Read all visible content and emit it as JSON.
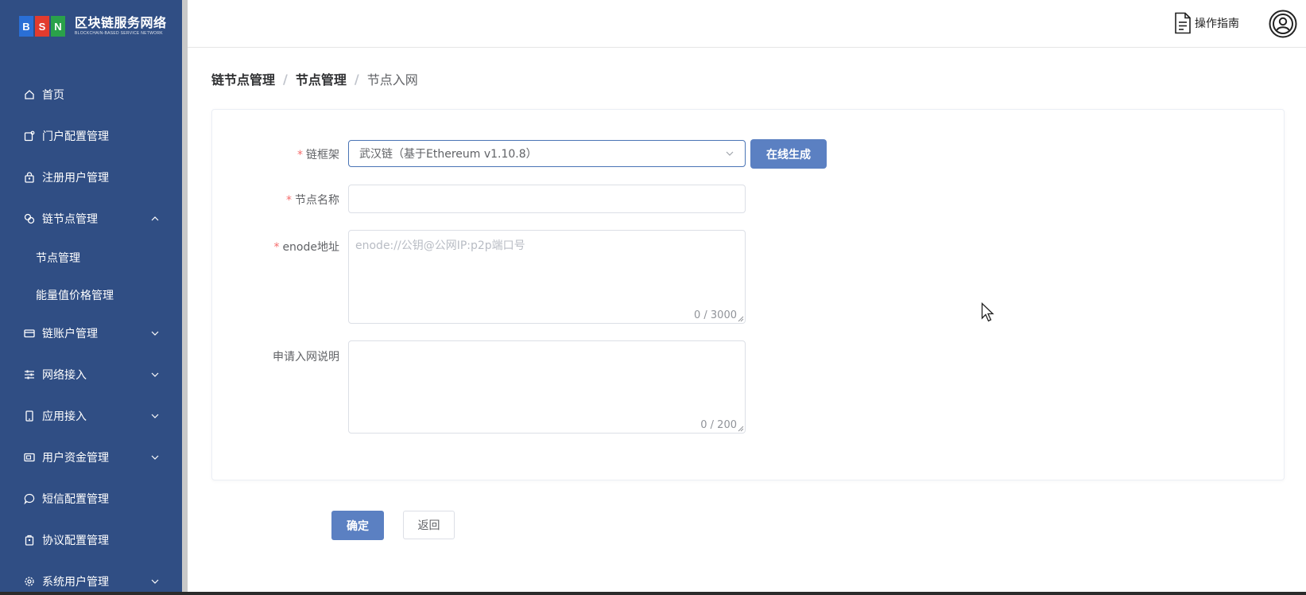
{
  "brand": {
    "letters": [
      "B",
      "S",
      "N"
    ],
    "letter_colors": [
      "#2a6fd6",
      "#e23b2e",
      "#2aa14a"
    ],
    "title": "区块链服务网络",
    "subtitle": "BLOCKCHAIN-BASED SERVICE NETWORK"
  },
  "sidebar": {
    "items": [
      {
        "label": "首页",
        "icon": "home-icon"
      },
      {
        "label": "门户配置管理",
        "icon": "portal-icon"
      },
      {
        "label": "注册用户管理",
        "icon": "user-lock-icon"
      },
      {
        "label": "链节点管理",
        "icon": "node-icon",
        "expanded": true
      },
      {
        "label": "链账户管理",
        "icon": "card-icon"
      },
      {
        "label": "网络接入",
        "icon": "sliders-icon"
      },
      {
        "label": "应用接入",
        "icon": "mobile-icon"
      },
      {
        "label": "用户资金管理",
        "icon": "wallet-icon"
      },
      {
        "label": "短信配置管理",
        "icon": "chat-icon"
      },
      {
        "label": "协议配置管理",
        "icon": "protocol-icon"
      },
      {
        "label": "系统用户管理",
        "icon": "gear-icon"
      }
    ],
    "subitems": [
      {
        "label": "节点管理"
      },
      {
        "label": "能量值价格管理"
      }
    ]
  },
  "header": {
    "guide_label": "操作指南"
  },
  "breadcrumb": {
    "items": [
      "链节点管理",
      "节点管理"
    ],
    "current": "节点入网",
    "separator": "/"
  },
  "form": {
    "framework": {
      "label": "链框架",
      "value": "武汉链（基于Ethereum v1.10.8）",
      "generate_label": "在线生成"
    },
    "node_name": {
      "label": "节点名称",
      "value": ""
    },
    "enode": {
      "label": "enode地址",
      "placeholder": "enode://公钥@公网IP:p2p端口号",
      "count": "0 / 3000"
    },
    "description": {
      "label": "申请入网说明",
      "count": "0 / 200"
    },
    "required_mark": "*"
  },
  "actions": {
    "confirm_label": "确定",
    "back_label": "返回"
  },
  "colors": {
    "sidebar_bg": "#304e84",
    "primary": "#5b80c2",
    "required": "#f56c6c"
  }
}
